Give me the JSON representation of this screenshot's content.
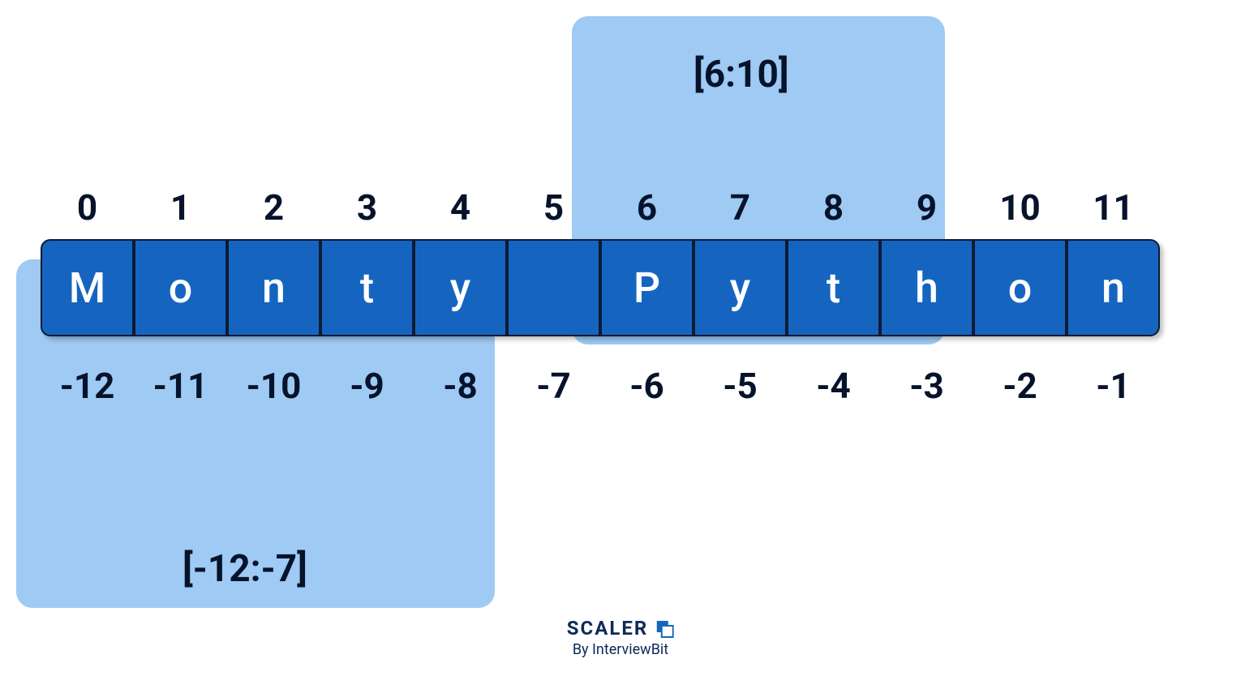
{
  "string": [
    "M",
    "o",
    "n",
    "t",
    "y",
    " ",
    "P",
    "y",
    "t",
    "h",
    "o",
    "n"
  ],
  "positive_indices": [
    "0",
    "1",
    "2",
    "3",
    "4",
    "5",
    "6",
    "7",
    "8",
    "9",
    "10",
    "11"
  ],
  "negative_indices": [
    "-12",
    "-11",
    "-10",
    "-9",
    "-8",
    "-7",
    "-6",
    "-5",
    "-4",
    "-3",
    "-2",
    "-1"
  ],
  "slices": {
    "top_label": "[6:10]",
    "bottom_label": "[-12:-7]"
  },
  "footer": {
    "brand": "SCALER",
    "byline": "By InterviewBit"
  }
}
